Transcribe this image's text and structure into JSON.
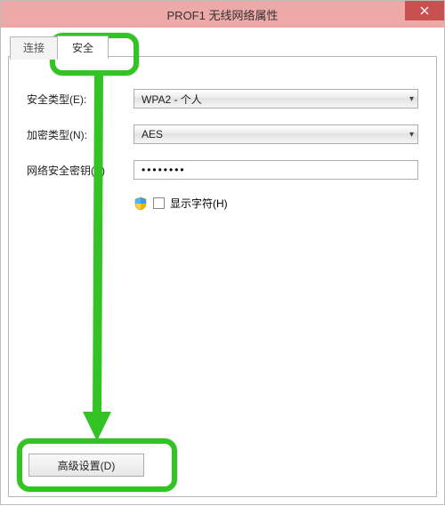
{
  "window": {
    "title": "PROF1 无线网络属性"
  },
  "tabs": {
    "connect": "连接",
    "security": "安全"
  },
  "form": {
    "security_type_label": "安全类型(E):",
    "security_type_value": "WPA2 - 个人",
    "encryption_label": "加密类型(N):",
    "encryption_value": "AES",
    "key_label": "网络安全密钥(K)",
    "key_value": "••••••••",
    "show_chars_label": "显示字符(H)"
  },
  "buttons": {
    "advanced": "高级设置(D)"
  }
}
